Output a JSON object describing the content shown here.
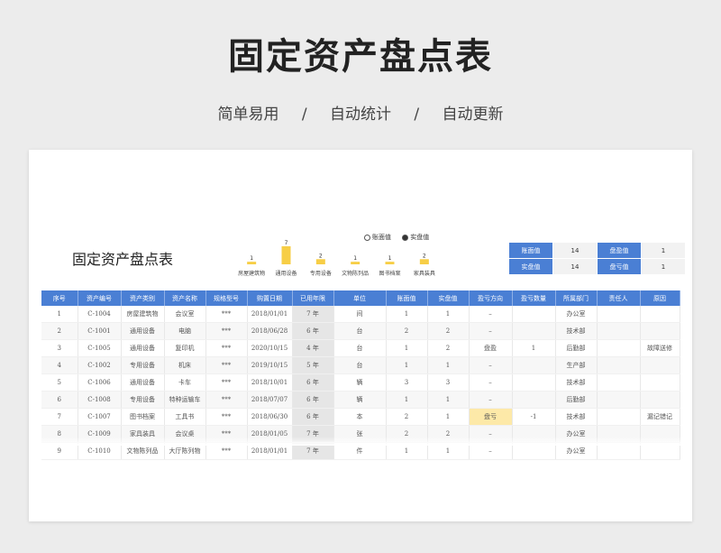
{
  "hero": {
    "title": "固定资产盘点表",
    "subtitle": [
      "简单易用",
      "/",
      "自动统计",
      "/",
      "自动更新"
    ]
  },
  "sheet": {
    "title": "固定资产盘点表"
  },
  "chart_data": {
    "type": "bar",
    "categories": [
      "房屋建筑物",
      "通用设备",
      "专用设备",
      "文物陈列品",
      "图书档案",
      "家具装具"
    ],
    "values": [
      1,
      7,
      2,
      1,
      1,
      2
    ],
    "legend": [
      "账面值",
      "实盘值"
    ],
    "legend_selected": "实盘值",
    "color": "#f7ce46",
    "ylim": [
      0,
      7
    ]
  },
  "summary": [
    [
      "账面值",
      "14",
      "盘盈值",
      "1"
    ],
    [
      "实盘值",
      "14",
      "盘亏值",
      "1"
    ]
  ],
  "table": {
    "headers": [
      "序号",
      "资产编号",
      "资产类别",
      "资产名称",
      "规格型号",
      "购置日期",
      "已用年限",
      "单位",
      "账面值",
      "实盘值",
      "盈亏方向",
      "盈亏数量",
      "所属部门",
      "责任人",
      "原因"
    ],
    "rows": [
      [
        "1",
        "C-1004",
        "房屋建筑物",
        "会议室",
        "***",
        "2018/01/01",
        "7 年",
        "间",
        "1",
        "1",
        "–",
        "",
        "办公室",
        "",
        ""
      ],
      [
        "2",
        "C-1001",
        "通用设备",
        "电脑",
        "***",
        "2018/06/28",
        "6 年",
        "台",
        "2",
        "2",
        "–",
        "",
        "技术部",
        "",
        ""
      ],
      [
        "3",
        "C-1005",
        "通用设备",
        "复印机",
        "***",
        "2020/10/15",
        "4 年",
        "台",
        "1",
        "2",
        "盘盈",
        "1",
        "后勤部",
        "",
        "故障送修"
      ],
      [
        "4",
        "C-1002",
        "专用设备",
        "机床",
        "***",
        "2019/10/15",
        "5 年",
        "台",
        "1",
        "1",
        "–",
        "",
        "生产部",
        "",
        ""
      ],
      [
        "5",
        "C-1006",
        "通用设备",
        "卡车",
        "***",
        "2018/10/01",
        "6 年",
        "辆",
        "3",
        "3",
        "–",
        "",
        "技术部",
        "",
        ""
      ],
      [
        "6",
        "C-1008",
        "专用设备",
        "特种运输车",
        "***",
        "2018/07/07",
        "6 年",
        "辆",
        "1",
        "1",
        "–",
        "",
        "后勤部",
        "",
        ""
      ],
      [
        "7",
        "C-1007",
        "图书档案",
        "工具书",
        "***",
        "2018/06/30",
        "6 年",
        "本",
        "2",
        "1",
        "盘亏",
        "-1",
        "技术部",
        "",
        "漏记错记"
      ],
      [
        "8",
        "C-1009",
        "家具装具",
        "会议桌",
        "***",
        "2018/01/05",
        "7 年",
        "张",
        "2",
        "2",
        "–",
        "",
        "办公室",
        "",
        ""
      ],
      [
        "9",
        "C-1010",
        "文物陈列品",
        "大厅陈列物",
        "***",
        "2018/01/01",
        "7 年",
        "件",
        "1",
        "1",
        "–",
        "",
        "办公室",
        "",
        ""
      ]
    ]
  }
}
